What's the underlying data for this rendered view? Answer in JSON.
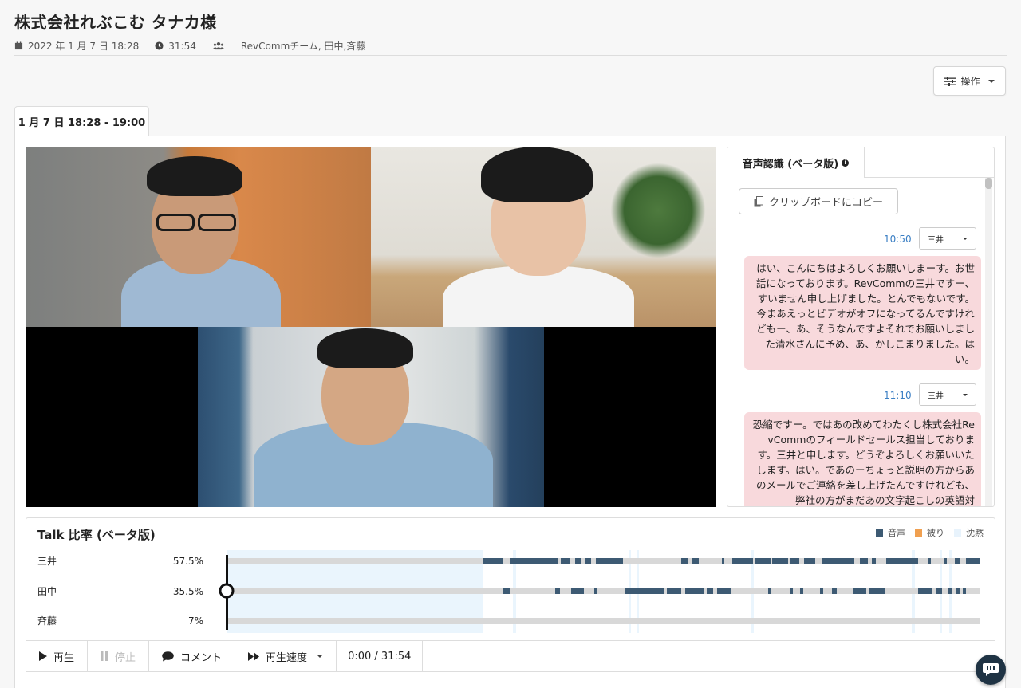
{
  "header": {
    "title": "株式会社れぶこむ タナカ様",
    "date": "2022 年 1 月 7 日 18:28",
    "duration": "31:54",
    "participants": "RevCommチーム, 田中,斉藤"
  },
  "actions": {
    "ops_label": "操作"
  },
  "session_tab": {
    "label": "1 月 7 日 18:28 - 19:00"
  },
  "transcript": {
    "tab_label": "音声認識 (ベータ版)",
    "copy_label": "クリップボードにコピー",
    "messages": [
      {
        "time": "10:50",
        "speaker": "三井",
        "text": "はい、こんにちはよろしくお願いしまーす。お世話になっております。RevCommの三井ですー、すいません申し上げました。とんでもないです。今まあえっとビデオがオフになってるんですけれどもー、あ、そうなんですよそれでお願いしました清水さんに予め、あ、かしこまりました。はい。"
      },
      {
        "time": "11:10",
        "speaker": "三井",
        "text": "恐縮ですー。ではあの改めてわたくし株式会社RevCommのフィールドセールス担当しております。三井と申します。どうぞよろしくお願いいたします。はい。であのーちょっと説明の方からあのメールでご連絡を差し上げたんですけれども、弊社の方がまだあの文字起こしの英語対"
      }
    ]
  },
  "talk": {
    "title": "Talk 比率 (ベータ版)",
    "legend": [
      {
        "label": "音声",
        "color": "#3d5a73"
      },
      {
        "label": "被り",
        "color": "#f0a050"
      },
      {
        "label": "沈黙",
        "color": "#e8f3fc"
      }
    ],
    "speakers": [
      {
        "name": "三井",
        "ratio": "57.5%"
      },
      {
        "name": "田中",
        "ratio": "35.5%"
      },
      {
        "name": "斉藤",
        "ratio": "7%"
      }
    ]
  },
  "controls": {
    "play": "再生",
    "stop": "停止",
    "comment": "コメント",
    "speed": "再生速度",
    "time": "0:00 / 31:54"
  }
}
